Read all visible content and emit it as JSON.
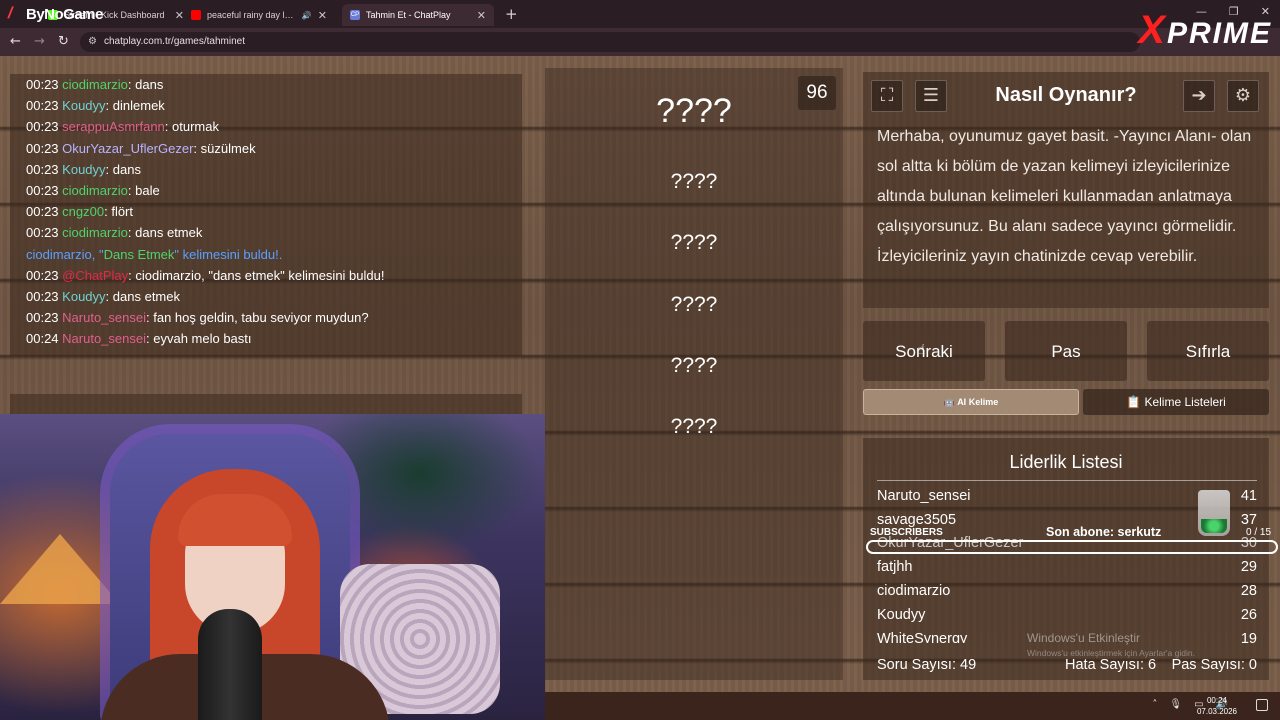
{
  "browser": {
    "brand": "ByNoGame",
    "tabs": [
      {
        "label": "Stream - Kick Dashboard",
        "active": false,
        "favicon": "kick-icon"
      },
      {
        "label": "peaceful rainy day lofi ☁",
        "active": false,
        "favicon": "youtube-icon"
      },
      {
        "label": "Tahmin Et - ChatPlay",
        "active": true,
        "favicon": "chatplay-icon",
        "favicon_text": "CP"
      }
    ],
    "url": "chatplay.com.tr/games/tahminet",
    "overlay_logo": "PRIME",
    "overlay_logo_x": "X"
  },
  "chat": {
    "lines": [
      {
        "time": "00:23",
        "user": "ciodimarzio",
        "color": "#4fd36b",
        "msg": "dans"
      },
      {
        "time": "00:23",
        "user": "Koudyy",
        "color": "#6fd2d2",
        "msg": "dinlemek"
      },
      {
        "time": "00:23",
        "user": "serappuAsmrfann",
        "color": "#e0608c",
        "msg": "oturmak"
      },
      {
        "time": "00:23",
        "user": "OkurYazar_UflerGezer",
        "color": "#b7b3ff",
        "msg": "süzülmek"
      },
      {
        "time": "00:23",
        "user": "Koudyy",
        "color": "#6fd2d2",
        "msg": "dans"
      },
      {
        "time": "00:23",
        "user": "ciodimarzio",
        "color": "#4fd36b",
        "msg": "bale"
      },
      {
        "time": "00:23",
        "user": "cngz00",
        "color": "#4fd36b",
        "msg": "flört"
      },
      {
        "time": "00:23",
        "user": "ciodimarzio",
        "color": "#4fd36b",
        "msg": "dans etmek"
      }
    ],
    "system_line": {
      "prefix": "ciodimarzio, \"",
      "keyword": "Dans Etmek",
      "suffix": "\" kelimesini buldu!."
    },
    "chatplay_line": {
      "time": "00:23",
      "user": "@ChatPlay",
      "msg": "ciodimarzio, \"dans etmek\" kelimesini buldu!"
    },
    "tail": [
      {
        "time": "00:23",
        "user": "Koudyy",
        "color": "#6fd2d2",
        "msg": "dans etmek"
      },
      {
        "time": "00:23",
        "user": "Naruto_sensei",
        "color": "#e0608c",
        "msg": "fan hoş geldin, tabu seviyor muydun?"
      },
      {
        "time": "00:24",
        "user": "Naruto_sensei",
        "color": "#e0608c",
        "msg": "eyvah melo bastı"
      }
    ]
  },
  "game": {
    "counter": "96",
    "words": [
      "????",
      "????",
      "????",
      "????",
      "????",
      "????"
    ]
  },
  "howto": {
    "title": "Nasıl Oynanır?",
    "text": "Merhaba, oyunumuz gayet basit. -Yayıncı Alanı- olan sol altta ki bölüm de yazan kelimeyi izleyicilerinize altında bulunan kelimeleri kullanmadan anlatmaya çalışıyorsunuz. Bu alanı sadece yayıncı görmelidir. İzleyicileriniz yayın chatinizde cevap verebilir."
  },
  "actions": {
    "next": "Sonraki",
    "pass": "Pas",
    "reset": "Sıfırla",
    "ai_word": "AI Kelime",
    "word_lists": "Kelime Listeleri"
  },
  "leaderboard": {
    "title": "Liderlik Listesi",
    "rows": [
      {
        "name": "Naruto_sensei",
        "score": "41"
      },
      {
        "name": "savage3505",
        "score": "37"
      },
      {
        "name": "OkurYazar_UflerGezer",
        "score": "30"
      },
      {
        "name": "fatjhh",
        "score": "29"
      },
      {
        "name": "ciodimarzio",
        "score": "28"
      },
      {
        "name": "Koudyy",
        "score": "26"
      },
      {
        "name": "WhiteSynergy",
        "score": "19"
      }
    ],
    "questions": "Soru Sayısı: 49",
    "errors": "Hata Sayısı: 6",
    "passes": "Pas Sayısı: 0"
  },
  "subscribers": {
    "label": "SUBSCRIBERS",
    "last": "Son abone: serkutz",
    "count": "0 / 15"
  },
  "windows": {
    "watermark": "Windows'u Etkinleştir",
    "watermark_sub": "Windows'u etkinleştirmek için Ayarlar'a gidin.",
    "time": "00:24",
    "date": "07.03.2026"
  }
}
